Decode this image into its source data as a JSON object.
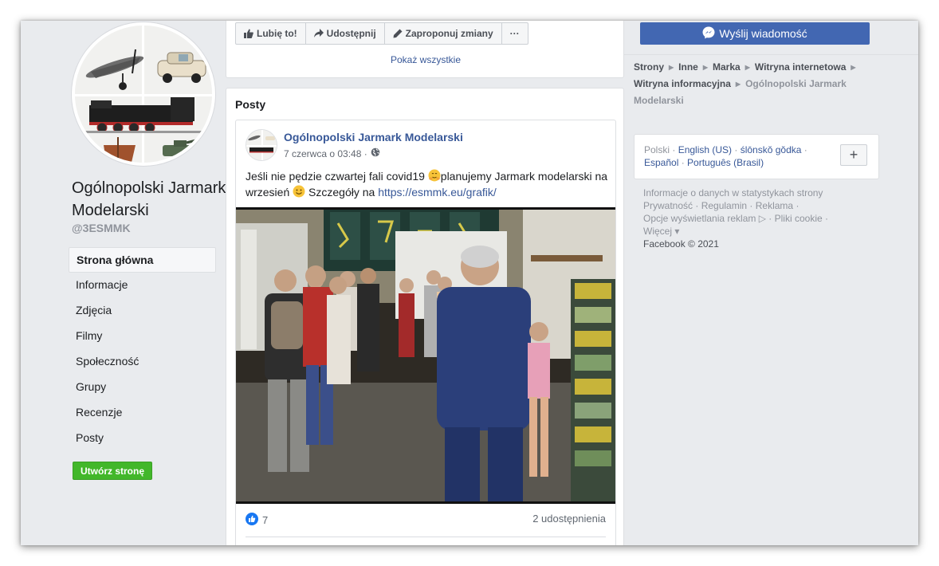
{
  "page": {
    "name": "Ogólnopolski Jarmark Modelarski",
    "handle": "@3ESMMK"
  },
  "nav": {
    "items": [
      {
        "label": "Strona główna",
        "active": true
      },
      {
        "label": "Informacje"
      },
      {
        "label": "Zdjęcia"
      },
      {
        "label": "Filmy"
      },
      {
        "label": "Społeczność"
      },
      {
        "label": "Grupy"
      },
      {
        "label": "Recenzje"
      },
      {
        "label": "Posty"
      }
    ],
    "create_page": "Utwórz stronę"
  },
  "actions": {
    "like": "Lubię to!",
    "share": "Udostępnij",
    "suggest": "Zaproponuj zmiany",
    "more": "···"
  },
  "show_all": "Pokaż wszystkie",
  "message_button": "Wyślij wiadomość",
  "breadcrumb": {
    "items": [
      "Strony",
      "Inne",
      "Marka",
      "Witryna internetowa",
      "Witryna informacyjna"
    ],
    "current": "Ogólnopolski Jarmark Modelarski"
  },
  "posts": {
    "heading": "Posty",
    "post": {
      "author": "Ogólnopolski Jarmark Modelarski",
      "date": "7 czerwca o 03:48 ·",
      "text_1": "Jeśli nie pędzie czwartej fali covid19 ",
      "text_2": "planujemy Jarmark modelarski na wrzesień ",
      "text_3": " Szczegóły na ",
      "link": "https://esmmk.eu/grafik/",
      "likes": "7",
      "shares": "2 udostępnienia"
    }
  },
  "languages": {
    "current": "Polski",
    "sep": " · ",
    "options": [
      "English (US)",
      "ślōnskŏ gŏdka",
      "Español",
      "Português (Brasil)"
    ],
    "add": "+"
  },
  "footer": {
    "links": [
      "Informacje o danych w statystykach strony",
      "Prywatność",
      "Regulamin",
      "Reklama",
      "Opcje wyświetlania reklam",
      "Pliki cookie",
      "Więcej"
    ],
    "copyright": "Facebook © 2021"
  },
  "colors": {
    "fb_blue": "#4267b2",
    "link_blue": "#385898",
    "green": "#42b72a",
    "background": "#e9ebee"
  }
}
